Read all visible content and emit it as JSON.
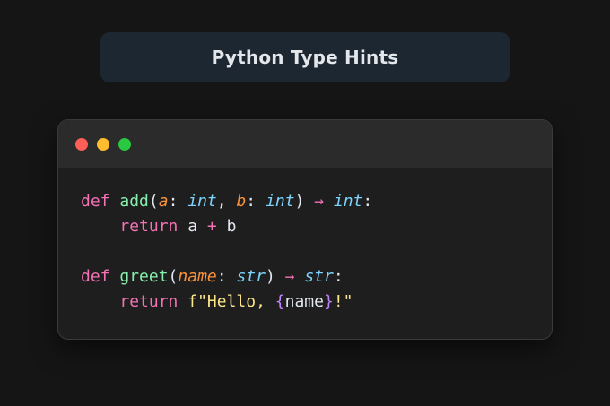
{
  "page": {
    "title": "Python Type Hints"
  },
  "window": {
    "controls": [
      {
        "name": "close",
        "color": "#ff5f57"
      },
      {
        "name": "minimize",
        "color": "#febc2e"
      },
      {
        "name": "maximize",
        "color": "#28c840"
      }
    ]
  },
  "code": {
    "line1": {
      "kw": "def",
      "fn": "add",
      "open": "(",
      "p1": "a",
      "c1": ":",
      "t1": "int",
      "sep": ",",
      "p2": "b",
      "c2": ":",
      "t2": "int",
      "close": ")",
      "arrow": "→",
      "ret": "int",
      "colon": ":"
    },
    "line2": {
      "indent": "    ",
      "kw": "return",
      "a": "a",
      "plus": "+",
      "b": "b"
    },
    "line4": {
      "kw": "def",
      "fn": "greet",
      "open": "(",
      "p1": "name",
      "c1": ":",
      "t1": "str",
      "close": ")",
      "arrow": "→",
      "ret": "str",
      "colon": ":"
    },
    "line5": {
      "indent": "    ",
      "kw": "return",
      "str_start": "f\"Hello, ",
      "brace_open": "{",
      "var": "name",
      "brace_close": "}",
      "str_end": "!\""
    }
  },
  "colors": {
    "keyword": "#f472b6",
    "function": "#86efac",
    "parameter": "#fb923c",
    "type": "#7dd3fc",
    "string": "#fde68a",
    "brace": "#c084fc",
    "text": "#e2e8f0",
    "background": "#151515",
    "banner": "#1c2732",
    "window": "#1e1e1e",
    "titlebar": "#2b2b2b"
  }
}
